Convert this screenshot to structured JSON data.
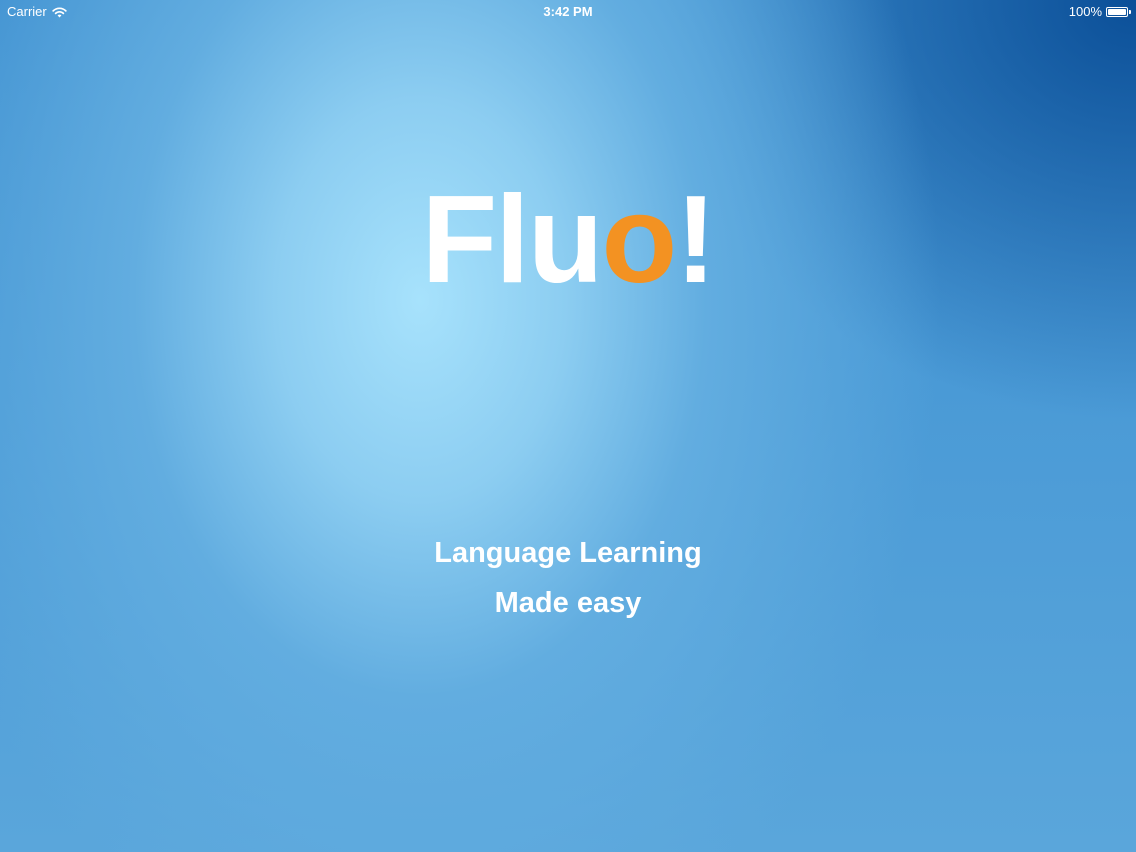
{
  "status_bar": {
    "carrier": "Carrier",
    "time": "3:42 PM",
    "battery_percent": "100%",
    "battery_level": 1.0,
    "icons": [
      "wifi-icon",
      "battery-icon"
    ]
  },
  "splash": {
    "logo": {
      "part1": "Flu",
      "accent_letter": "o",
      "part2": "!",
      "text_color": "#ffffff",
      "accent_color": "#f39222"
    },
    "tagline_line1": "Language Learning",
    "tagline_line2": "Made easy"
  },
  "colors": {
    "background_light": "#a7e2fc",
    "background_mid": "#4a9ad6",
    "background_dark": "#0b4f98"
  }
}
